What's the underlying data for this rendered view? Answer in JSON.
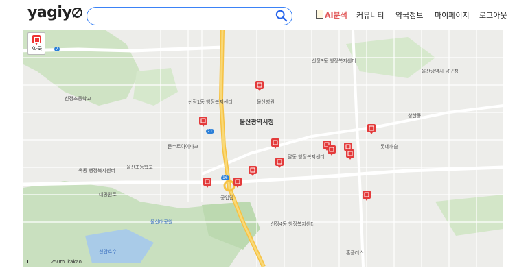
{
  "header": {
    "logo": "yagiy",
    "search": {
      "value": "",
      "placeholder": ""
    },
    "nav": {
      "ai_analysis": "AI분석",
      "community": "커뮤니티",
      "pharmacy_info": "약국정보",
      "my_page": "마이페이지",
      "logout": "로그아웃"
    }
  },
  "map": {
    "layer_button_label": "약국",
    "scale_label": "250m",
    "provider": "kakao",
    "marker_color": "#e33b3b",
    "labels": {
      "city_hall": "울산광역시청",
      "namgu_office": "울산광역시 남구청",
      "district_a": "신정1동 행정복지센터",
      "district_b": "신정3동 행정복지센터",
      "district_c": "달동 행정복지센터",
      "district_d": "신정4동 행정복지센터",
      "district_e": "옥동 행정복지센터",
      "samsan": "삼산동",
      "station": "공업탑",
      "hospital_a": "울산병원",
      "park": "울산대공원",
      "school_a": "신정초등학교",
      "school_b": "울산초등학교",
      "apt_a": "문수로아이파크",
      "apt_b": "롯데캐슬",
      "mart": "홈플러스",
      "ktx": "대공원로",
      "lake": "선암호수"
    },
    "road_numbers": [
      "7",
      "16",
      "21"
    ]
  }
}
